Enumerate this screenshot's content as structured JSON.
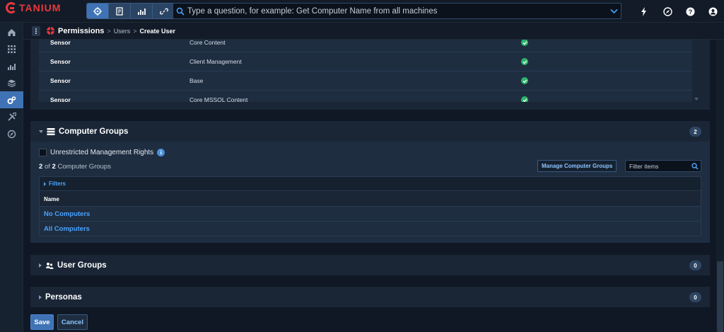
{
  "app": {
    "logo": "TANIUM",
    "brand_color": "#e8383d",
    "accent_color": "#3f73b5",
    "link_color": "#4aa3ff"
  },
  "topbar": {
    "modes": [
      {
        "icon": "target-icon",
        "active": true
      },
      {
        "icon": "file-icon",
        "active": false
      },
      {
        "icon": "bar-chart-icon",
        "active": false
      },
      {
        "icon": "link-icon",
        "active": false
      }
    ],
    "search_placeholder": "Type a question, for example: Get Computer Name from all machines",
    "icons": [
      "lightning-icon",
      "compass-icon",
      "help-icon",
      "user-icon"
    ]
  },
  "rail": {
    "items": [
      {
        "icon": "home-icon",
        "active": false
      },
      {
        "icon": "apps-grid-icon",
        "active": false
      },
      {
        "icon": "reports-icon",
        "active": false
      },
      {
        "icon": "modules-icon",
        "active": false
      },
      {
        "icon": "admin-gears-icon",
        "active": true
      },
      {
        "icon": "tools-icon",
        "active": false
      },
      {
        "icon": "compass-icon",
        "active": false
      }
    ]
  },
  "breadcrumb": {
    "title": "Permissions",
    "items": [
      "Users",
      "Create User"
    ]
  },
  "sensors": {
    "rows": [
      {
        "type": "Sensor",
        "name": "Core Content",
        "enabled": true
      },
      {
        "type": "Sensor",
        "name": "Client Management",
        "enabled": true
      },
      {
        "type": "Sensor",
        "name": "Base",
        "enabled": true
      },
      {
        "type": "Sensor",
        "name": "Core MSSQL Content",
        "enabled": true
      }
    ]
  },
  "computer_groups": {
    "title": "Computer Groups",
    "count": "2",
    "unrestricted_label": "Unrestricted Management Rights",
    "shown": "2",
    "of_label": "of",
    "total": "2",
    "noun": "Computer Groups",
    "manage_button": "Manage Computer Groups",
    "filter_placeholder": "Filter items",
    "filters_label": "Filters",
    "column_header": "Name",
    "rows": [
      "No Computers",
      "All Computers"
    ]
  },
  "user_groups": {
    "title": "User Groups",
    "count": "0"
  },
  "personas": {
    "title": "Personas",
    "count": "0"
  },
  "actions": {
    "save": "Save",
    "cancel": "Cancel"
  }
}
